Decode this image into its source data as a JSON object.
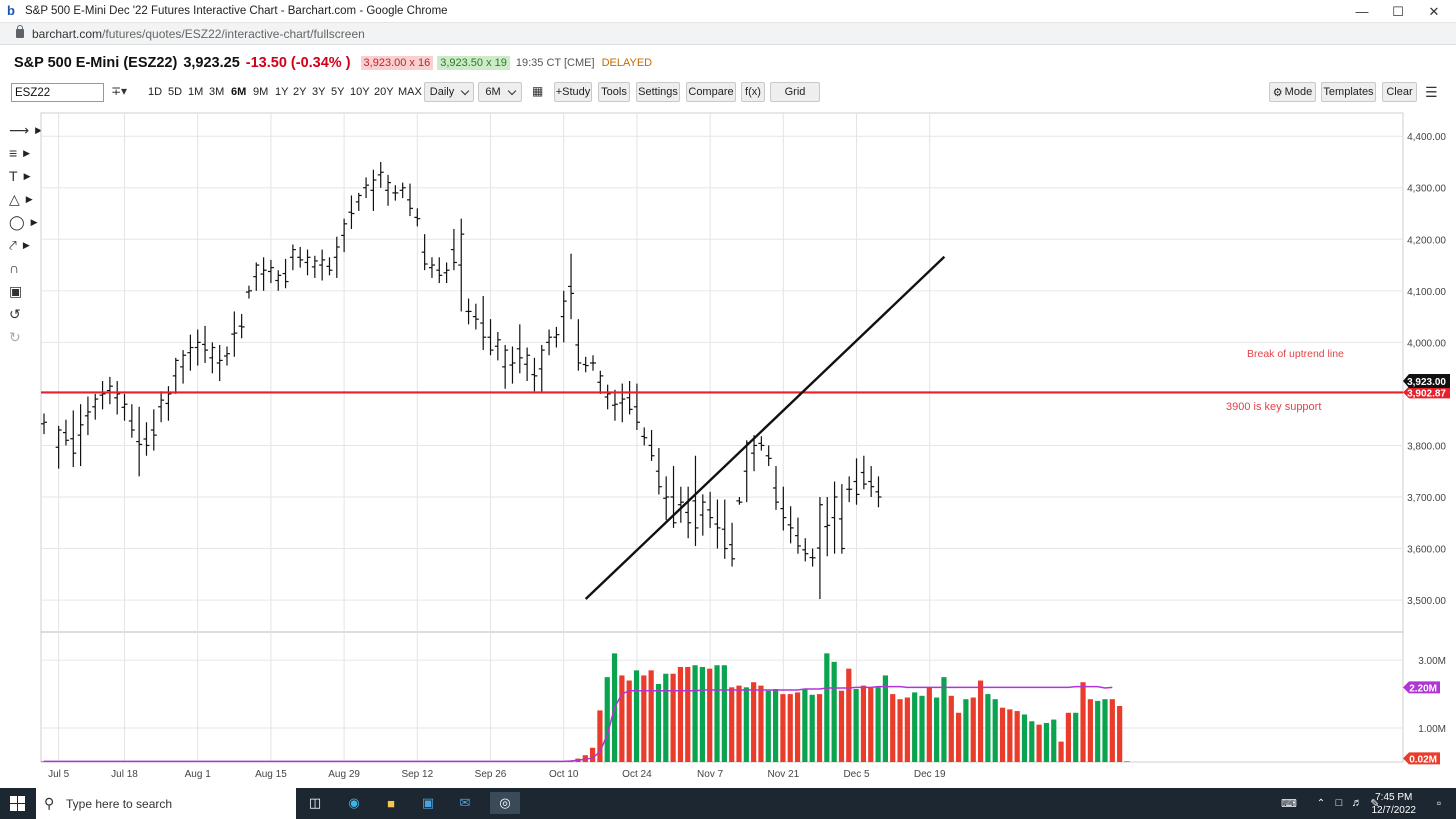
{
  "browser": {
    "window_title": "S&P 500 E-Mini Dec '22 Futures Interactive Chart - Barchart.com - Google Chrome",
    "url_host": "barchart.com",
    "url_path": "/futures/quotes/ESZ22/interactive-chart/fullscreen",
    "favicon_letter": "b"
  },
  "quote": {
    "symbol_name": "S&P 500 E-Mini (ESZ22)",
    "last": "3,923.25",
    "change": "-13.50 (-0.34% )",
    "bid": "3,923.00 x 16",
    "ask": "3,923.50 x 19",
    "time": "19:35 CT [CME]",
    "status": "DELAYED"
  },
  "toolbar": {
    "symbol_input": "ESZ22",
    "periods": [
      "1D",
      "5D",
      "1M",
      "3M",
      "6M",
      "9M",
      "1Y",
      "2Y",
      "3Y",
      "5Y",
      "10Y",
      "20Y",
      "MAX"
    ],
    "active_period": "6M",
    "interval": "Daily",
    "range": "6M",
    "study": "+Study",
    "tools": "Tools",
    "settings": "Settings",
    "compare": "Compare",
    "fx": "f(x)",
    "grid": "Grid",
    "mode": "Mode",
    "templates": "Templates",
    "clear": "Clear"
  },
  "chart_data": {
    "type": "ohlc-bar",
    "interval": "Daily",
    "x_ticks": [
      "Jul 5",
      "Jul 18",
      "Aug 1",
      "Aug 15",
      "Aug 29",
      "Sep 12",
      "Sep 26",
      "Oct 10",
      "Oct 24",
      "Nov 7",
      "Nov 21",
      "Dec 5",
      "Dec 19"
    ],
    "y_ticks": [
      "4,400.00",
      "4,300.00",
      "4,200.00",
      "4,100.00",
      "4,000.00",
      "3,800.00",
      "3,700.00",
      "3,600.00",
      "3,500.00"
    ],
    "ylim": [
      3440,
      4445
    ],
    "last_price_label": "3,923.00",
    "support_price_label": "3,902.87",
    "support_level": 3902.87,
    "support_annotation": "3900 is key support",
    "trendline_annotation": "Break of uptrend line",
    "trendline": {
      "start": [
        "Oct 13",
        3502
      ],
      "end": [
        "Dec 21",
        4166
      ]
    },
    "bars": [
      {
        "d": "Jul 1",
        "h": 3862,
        "l": 3822,
        "c": 3845
      },
      {
        "d": "Jul 5",
        "h": 3838,
        "l": 3755,
        "c": 3830
      },
      {
        "d": "Jul 6",
        "h": 3850,
        "l": 3800,
        "c": 3810
      },
      {
        "d": "Jul 7",
        "h": 3868,
        "l": 3758,
        "c": 3785
      },
      {
        "d": "Jul 8",
        "h": 3880,
        "l": 3760,
        "c": 3840
      },
      {
        "d": "Jul 11",
        "h": 3895,
        "l": 3820,
        "c": 3865
      },
      {
        "d": "Jul 12",
        "h": 3900,
        "l": 3850,
        "c": 3890
      },
      {
        "d": "Jul 13",
        "h": 3925,
        "l": 3870,
        "c": 3900
      },
      {
        "d": "Jul 14",
        "h": 3933,
        "l": 3880,
        "c": 3915
      },
      {
        "d": "Jul 15",
        "h": 3925,
        "l": 3860,
        "c": 3900
      },
      {
        "d": "Jul 18",
        "h": 3900,
        "l": 3848,
        "c": 3880
      },
      {
        "d": "Jul 19",
        "h": 3880,
        "l": 3815,
        "c": 3830
      },
      {
        "d": "Jul 20",
        "h": 3875,
        "l": 3740,
        "c": 3802
      },
      {
        "d": "Jul 21",
        "h": 3845,
        "l": 3780,
        "c": 3800
      },
      {
        "d": "Jul 22",
        "h": 3870,
        "l": 3790,
        "c": 3820
      },
      {
        "d": "Jul 25",
        "h": 3905,
        "l": 3845,
        "c": 3888
      },
      {
        "d": "Jul 26",
        "h": 3915,
        "l": 3848,
        "c": 3900
      },
      {
        "d": "Jul 27",
        "h": 3970,
        "l": 3900,
        "c": 3965
      },
      {
        "d": "Jul 28",
        "h": 3985,
        "l": 3920,
        "c": 3975
      },
      {
        "d": "Jul 29",
        "h": 4015,
        "l": 3945,
        "c": 3990
      },
      {
        "d": "Aug 1",
        "h": 4025,
        "l": 3955,
        "c": 4000
      },
      {
        "d": "Aug 2",
        "h": 4032,
        "l": 3960,
        "c": 3985
      },
      {
        "d": "Aug 3",
        "h": 4000,
        "l": 3940,
        "c": 3990
      },
      {
        "d": "Aug 4",
        "h": 3995,
        "l": 3925,
        "c": 3965
      },
      {
        "d": "Aug 5",
        "h": 3992,
        "l": 3955,
        "c": 3978
      },
      {
        "d": "Aug 8",
        "h": 4060,
        "l": 3972,
        "c": 4018
      },
      {
        "d": "Aug 9",
        "h": 4055,
        "l": 4008,
        "c": 4030
      },
      {
        "d": "Aug 10",
        "h": 4110,
        "l": 4085,
        "c": 4100
      },
      {
        "d": "Aug 11",
        "h": 4155,
        "l": 4100,
        "c": 4150
      },
      {
        "d": "Aug 12",
        "h": 4165,
        "l": 4100,
        "c": 4140
      },
      {
        "d": "Aug 15",
        "h": 4160,
        "l": 4115,
        "c": 4145
      },
      {
        "d": "Aug 16",
        "h": 4140,
        "l": 4100,
        "c": 4130
      },
      {
        "d": "Aug 17",
        "h": 4162,
        "l": 4105,
        "c": 4118
      },
      {
        "d": "Aug 18",
        "h": 4190,
        "l": 4140,
        "c": 4180
      },
      {
        "d": "Aug 19",
        "h": 4185,
        "l": 4145,
        "c": 4160
      },
      {
        "d": "Aug 22",
        "h": 4180,
        "l": 4130,
        "c": 4165
      },
      {
        "d": "Aug 23",
        "h": 4168,
        "l": 4125,
        "c": 4158
      },
      {
        "d": "Aug 24",
        "h": 4180,
        "l": 4120,
        "c": 4160
      },
      {
        "d": "Aug 25",
        "h": 4165,
        "l": 4130,
        "c": 4140
      },
      {
        "d": "Aug 26",
        "h": 4205,
        "l": 4125,
        "c": 4185
      },
      {
        "d": "Aug 29",
        "h": 4240,
        "l": 4175,
        "c": 4230
      },
      {
        "d": "Aug 30",
        "h": 4285,
        "l": 4220,
        "c": 4250
      },
      {
        "d": "Aug 31",
        "h": 4290,
        "l": 4255,
        "c": 4285
      },
      {
        "d": "Sep 1",
        "h": 4320,
        "l": 4280,
        "c": 4305
      },
      {
        "d": "Sep 2",
        "h": 4335,
        "l": 4255,
        "c": 4315
      },
      {
        "d": "Sep 5",
        "h": 4350,
        "l": 4300,
        "c": 4330
      },
      {
        "d": "Sep 6",
        "h": 4325,
        "l": 4265,
        "c": 4310
      },
      {
        "d": "Sep 7",
        "h": 4305,
        "l": 4275,
        "c": 4290
      },
      {
        "d": "Sep 8",
        "h": 4310,
        "l": 4280,
        "c": 4300
      },
      {
        "d": "Sep 9",
        "h": 4308,
        "l": 4245,
        "c": 4260
      },
      {
        "d": "Sep 12",
        "h": 4260,
        "l": 4225,
        "c": 4240
      },
      {
        "d": "Sep 13",
        "h": 4210,
        "l": 4140,
        "c": 4152
      },
      {
        "d": "Sep 14",
        "h": 4165,
        "l": 4125,
        "c": 4150
      },
      {
        "d": "Sep 15",
        "h": 4165,
        "l": 4115,
        "c": 4130
      },
      {
        "d": "Sep 16",
        "h": 4155,
        "l": 4115,
        "c": 4140
      },
      {
        "d": "Sep 19",
        "h": 4220,
        "l": 4140,
        "c": 4155
      },
      {
        "d": "Sep 20",
        "h": 4240,
        "l": 4060,
        "c": 4210
      },
      {
        "d": "Sep 21",
        "h": 4085,
        "l": 4035,
        "c": 4060
      },
      {
        "d": "Sep 22",
        "h": 4075,
        "l": 4025,
        "c": 4045
      },
      {
        "d": "Sep 23",
        "h": 4090,
        "l": 3985,
        "c": 4010
      },
      {
        "d": "Sep 26",
        "h": 4045,
        "l": 3975,
        "c": 3985
      },
      {
        "d": "Sep 27",
        "h": 4020,
        "l": 3965,
        "c": 4005
      },
      {
        "d": "Sep 28",
        "h": 3995,
        "l": 3910,
        "c": 3985
      },
      {
        "d": "Sep 29",
        "h": 3992,
        "l": 3920,
        "c": 3960
      },
      {
        "d": "Sep 30",
        "h": 4035,
        "l": 3940,
        "c": 3970
      },
      {
        "d": "Oct 3",
        "h": 3990,
        "l": 3925,
        "c": 3975
      },
      {
        "d": "Oct 4",
        "h": 3970,
        "l": 3905,
        "c": 3935
      },
      {
        "d": "Oct 5",
        "h": 3995,
        "l": 3902,
        "c": 3985
      },
      {
        "d": "Oct 6",
        "h": 4025,
        "l": 3975,
        "c": 4010
      },
      {
        "d": "Oct 7",
        "h": 4030,
        "l": 3990,
        "c": 4015
      },
      {
        "d": "Oct 10",
        "h": 4100,
        "l": 4000,
        "c": 4080
      },
      {
        "d": "Oct 11",
        "h": 4172,
        "l": 4045,
        "c": 4095
      },
      {
        "d": "Oct 12",
        "h": 4045,
        "l": 3945,
        "c": 3960
      },
      {
        "d": "Oct 13",
        "h": 3972,
        "l": 3942,
        "c": 3955
      },
      {
        "d": "Oct 14",
        "h": 3975,
        "l": 3945,
        "c": 3960
      },
      {
        "d": "Oct 17",
        "h": 3945,
        "l": 3900,
        "c": 3935
      },
      {
        "d": "Oct 18",
        "h": 3918,
        "l": 3870,
        "c": 3900
      },
      {
        "d": "Oct 19",
        "h": 3908,
        "l": 3848,
        "c": 3880
      },
      {
        "d": "Oct 20",
        "h": 3920,
        "l": 3845,
        "c": 3890
      },
      {
        "d": "Oct 21",
        "h": 3925,
        "l": 3860,
        "c": 3870
      },
      {
        "d": "Oct 24",
        "h": 3920,
        "l": 3830,
        "c": 3845
      },
      {
        "d": "Oct 25",
        "h": 3835,
        "l": 3800,
        "c": 3815
      },
      {
        "d": "Oct 26",
        "h": 3830,
        "l": 3770,
        "c": 3780
      },
      {
        "d": "Oct 27",
        "h": 3795,
        "l": 3705,
        "c": 3720
      },
      {
        "d": "Oct 28",
        "h": 3740,
        "l": 3655,
        "c": 3700
      },
      {
        "d": "Oct 31",
        "h": 3760,
        "l": 3640,
        "c": 3650
      },
      {
        "d": "Nov 1",
        "h": 3720,
        "l": 3650,
        "c": 3690
      },
      {
        "d": "Nov 2",
        "h": 3720,
        "l": 3620,
        "c": 3650
      },
      {
        "d": "Nov 3",
        "h": 3780,
        "l": 3605,
        "c": 3640
      },
      {
        "d": "Nov 4",
        "h": 3705,
        "l": 3625,
        "c": 3690
      },
      {
        "d": "Nov 7",
        "h": 3710,
        "l": 3640,
        "c": 3660
      },
      {
        "d": "Nov 8",
        "h": 3695,
        "l": 3600,
        "c": 3640
      },
      {
        "d": "Nov 9",
        "h": 3695,
        "l": 3580,
        "c": 3600
      },
      {
        "d": "Nov 10",
        "h": 3650,
        "l": 3565,
        "c": 3580
      },
      {
        "d": "Nov 11",
        "h": 3700,
        "l": 3685,
        "c": 3690
      },
      {
        "d": "Nov 14",
        "h": 3810,
        "l": 3690,
        "c": 3805
      },
      {
        "d": "Nov 15",
        "h": 3820,
        "l": 3750,
        "c": 3800
      },
      {
        "d": "Nov 16",
        "h": 3818,
        "l": 3790,
        "c": 3800
      },
      {
        "d": "Nov 17",
        "h": 3800,
        "l": 3760,
        "c": 3775
      },
      {
        "d": "Nov 18",
        "h": 3760,
        "l": 3675,
        "c": 3690
      },
      {
        "d": "Nov 21",
        "h": 3720,
        "l": 3635,
        "c": 3660
      },
      {
        "d": "Nov 22",
        "h": 3682,
        "l": 3610,
        "c": 3640
      },
      {
        "d": "Nov 23",
        "h": 3660,
        "l": 3590,
        "c": 3605
      },
      {
        "d": "Nov 24",
        "h": 3620,
        "l": 3575,
        "c": 3590
      },
      {
        "d": "Nov 25",
        "h": 3600,
        "l": 3565,
        "c": 3582
      },
      {
        "d": "Nov 28",
        "h": 3700,
        "l": 3502,
        "c": 3685
      },
      {
        "d": "Nov 29",
        "h": 3700,
        "l": 3585,
        "c": 3645
      },
      {
        "d": "Nov 30",
        "h": 3730,
        "l": 3590,
        "c": 3700
      },
      {
        "d": "Dec 1",
        "h": 3725,
        "l": 3590,
        "c": 3600
      },
      {
        "d": "Dec 2",
        "h": 3740,
        "l": 3690,
        "c": 3715
      },
      {
        "d": "Dec 5",
        "h": 3775,
        "l": 3685,
        "c": 3705
      },
      {
        "d": "Dec 6",
        "h": 3780,
        "l": 3715,
        "c": 3725
      },
      {
        "d": "Dec 7",
        "h": 3760,
        "l": 3700,
        "c": 3720
      },
      {
        "d": "Dec 8",
        "h": 3740,
        "l": 3680,
        "c": 3700
      }
    ],
    "volume_axis": {
      "ticks": [
        "3.00M",
        "1.00M"
      ],
      "ylim": [
        0,
        3.8
      ],
      "current_label": "0.02M",
      "ma_label": "2.20M"
    },
    "volume": [
      0.02,
      0.02,
      0.02,
      0.02,
      0.02,
      0.02,
      0.02,
      0.02,
      0.02,
      0.02,
      0.02,
      0.02,
      0.02,
      0.02,
      0.02,
      0.02,
      0.02,
      0.02,
      0.02,
      0.02,
      0.02,
      0.02,
      0.02,
      0.02,
      0.02,
      0.02,
      0.02,
      0.02,
      0.02,
      0.02,
      0.02,
      0.02,
      0.02,
      0.02,
      0.02,
      0.02,
      0.02,
      0.02,
      0.02,
      0.02,
      0.02,
      0.02,
      0.02,
      0.02,
      0.02,
      0.02,
      0.02,
      0.02,
      0.02,
      0.02,
      0.02,
      0.02,
      0.02,
      0.02,
      0.02,
      0.02,
      0.02,
      0.02,
      0.02,
      0.02,
      0.02,
      0.02,
      0.02,
      0.02,
      0.02,
      0.02,
      0.02,
      0.02,
      0.02,
      0.02,
      0.02,
      0.02,
      0.04,
      0.1,
      0.2,
      0.42,
      1.52,
      2.5,
      3.2,
      2.55,
      2.4,
      2.7,
      2.55,
      2.7,
      2.3,
      2.6,
      2.6,
      2.8,
      2.8,
      2.85,
      2.8,
      2.75,
      2.85,
      2.85,
      2.2,
      2.25,
      2.2,
      2.35,
      2.25,
      2.1,
      2.15,
      2.0,
      2.0,
      2.05,
      2.15,
      1.98,
      2.0,
      3.2,
      2.95,
      2.1,
      2.75,
      2.15,
      2.25,
      2.2,
      2.2,
      2.55,
      2.0,
      1.85,
      1.9,
      2.05,
      1.95,
      2.2,
      1.9,
      2.5,
      1.95,
      1.45,
      1.85,
      1.9,
      2.4,
      2.0,
      1.85,
      1.6,
      1.55,
      1.5,
      1.4,
      1.2,
      1.1,
      1.15,
      1.25,
      0.6,
      1.45,
      1.45,
      2.35,
      1.85,
      1.8,
      1.85,
      1.85,
      1.65,
      0.02
    ],
    "volume_ma": [
      0.02,
      0.02,
      0.02,
      0.02,
      0.02,
      0.02,
      0.02,
      0.02,
      0.02,
      0.02,
      0.02,
      0.02,
      0.02,
      0.02,
      0.02,
      0.02,
      0.02,
      0.02,
      0.02,
      0.02,
      0.02,
      0.02,
      0.02,
      0.02,
      0.02,
      0.02,
      0.02,
      0.02,
      0.02,
      0.02,
      0.02,
      0.02,
      0.02,
      0.02,
      0.02,
      0.02,
      0.02,
      0.02,
      0.02,
      0.02,
      0.02,
      0.02,
      0.02,
      0.02,
      0.02,
      0.02,
      0.02,
      0.02,
      0.02,
      0.02,
      0.02,
      0.02,
      0.02,
      0.02,
      0.02,
      0.02,
      0.02,
      0.02,
      0.02,
      0.02,
      0.02,
      0.02,
      0.02,
      0.02,
      0.02,
      0.02,
      0.02,
      0.02,
      0.02,
      0.02,
      0.02,
      0.02,
      0.03,
      0.05,
      0.08,
      0.12,
      0.3,
      0.8,
      1.6,
      2.0,
      2.1,
      2.1,
      2.1,
      2.1,
      2.1,
      2.1,
      2.1,
      2.1,
      2.1,
      2.1,
      2.12,
      2.12,
      2.12,
      2.12,
      2.12,
      2.12,
      2.12,
      2.12,
      2.12,
      2.12,
      2.12,
      2.12,
      2.12,
      2.12,
      2.15,
      2.15,
      2.15,
      2.18,
      2.18,
      2.18,
      2.18,
      2.2,
      2.2,
      2.2,
      2.22,
      2.22,
      2.22,
      2.22,
      2.2,
      2.2,
      2.2,
      2.2,
      2.2,
      2.2,
      2.2,
      2.2,
      2.2,
      2.2,
      2.2,
      2.2,
      2.2,
      2.2,
      2.2,
      2.2,
      2.2,
      2.2,
      2.2,
      2.2,
      2.2,
      2.2,
      2.2,
      2.22,
      2.22,
      2.22,
      2.22,
      2.18,
      2.2
    ],
    "volume_colors": {
      "up": "#0aa34f",
      "down": "#ea3c2a",
      "ma": "#b035d6"
    }
  },
  "colors": {
    "support": "#e8202a",
    "trendline": "#111111",
    "annotation": "#e34248",
    "last_badge": "#111111"
  },
  "taskbar": {
    "search_placeholder": "Type here to search",
    "time": "7:45 PM",
    "date": "12/7/2022"
  }
}
